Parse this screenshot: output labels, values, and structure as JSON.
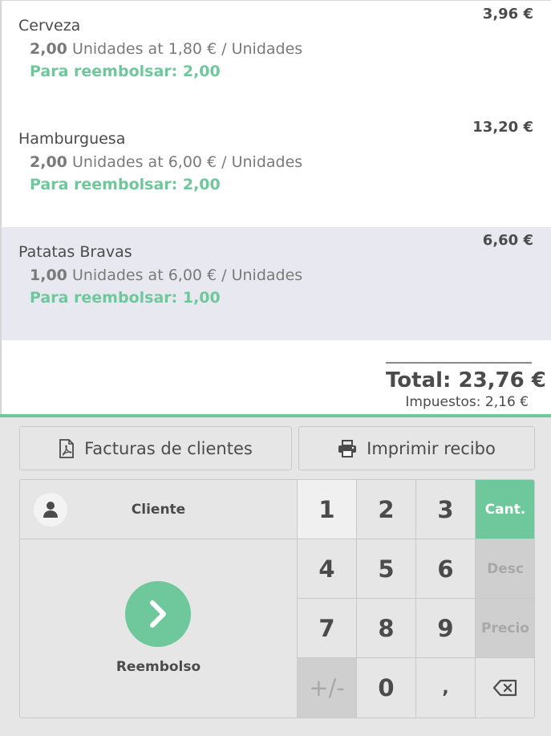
{
  "order": {
    "lines": [
      {
        "name": "Cerveza",
        "price": "3,96 €",
        "qty": "2,00",
        "detail": "Unidades at 1,80 € / Unidades",
        "refund": "Para reembolsar: 2,00",
        "selected": false
      },
      {
        "name": "Hamburguesa",
        "price": "13,20 €",
        "qty": "2,00",
        "detail": "Unidades at 6,00 € / Unidades",
        "refund": "Para reembolsar: 2,00",
        "selected": false
      },
      {
        "name": "Patatas Bravas",
        "price": "6,60 €",
        "qty": "1,00",
        "detail": "Unidades at 6,00 € / Unidades",
        "refund": "Para reembolsar: 1,00",
        "selected": true
      }
    ],
    "total": "Total: 23,76 €",
    "taxes": "Impuestos: 2,16 €"
  },
  "controls": {
    "invoices_label": "Facturas de clientes",
    "print_label": "Imprimir recibo"
  },
  "actionpad": {
    "customer_label": "Cliente",
    "refund_label": "Reembolso"
  },
  "numpad": {
    "k1": "1",
    "k2": "2",
    "k3": "3",
    "k4": "4",
    "k5": "5",
    "k6": "6",
    "k7": "7",
    "k8": "8",
    "k9": "9",
    "sign": "+/-",
    "k0": "0",
    "decimal": ",",
    "qty_mode": "Cant.",
    "disc_mode": "Desc",
    "price_mode": "Precio"
  },
  "colors": {
    "accent": "#6ec89b",
    "selected_row": "#e8e9f0"
  },
  "icons": {
    "invoices": "file-pdf-icon",
    "print": "printer-icon",
    "customer": "user-icon",
    "refund": "chevron-right-icon",
    "backspace": "backspace-icon"
  }
}
